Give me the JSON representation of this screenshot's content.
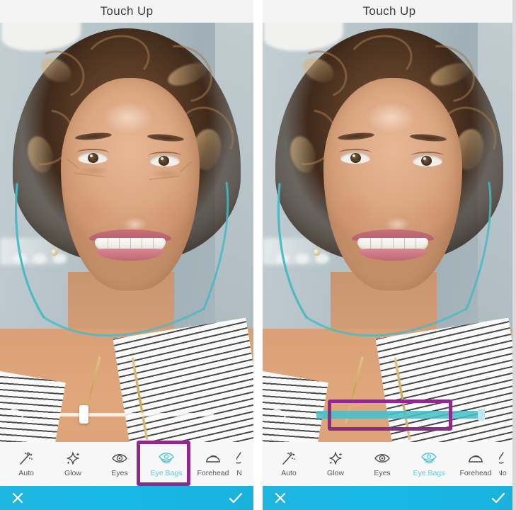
{
  "app": {
    "title": "Touch Up"
  },
  "panels": [
    {
      "id": "before",
      "title": "Touch Up",
      "slider": {
        "style": "white",
        "value_percent": 22,
        "track_color": "#ffffff",
        "knob_color": "#fdfdfd"
      },
      "undo_icon": "undo-arrow-icon",
      "highlight": {
        "target": "tool-eye-bags",
        "color": "#8e2a8b"
      },
      "tools": [
        {
          "label": "Auto",
          "icon": "magic-wand-icon",
          "active": false
        },
        {
          "label": "Glow",
          "icon": "sparkle-star-icon",
          "active": false
        },
        {
          "label": "Eyes",
          "icon": "eye-icon",
          "active": false
        },
        {
          "label": "Eye Bags",
          "icon": "eye-bags-icon",
          "active": true
        },
        {
          "label": "Forehead",
          "icon": "forehead-arch-icon",
          "active": false
        },
        {
          "label": "N",
          "icon": "nose-icon",
          "active": false
        }
      ],
      "actions": {
        "cancel_icon": "close-x-icon",
        "confirm_icon": "checkmark-icon",
        "bar_color": "#19b4e0"
      }
    },
    {
      "id": "after",
      "title": "Touch Up",
      "slider": {
        "style": "teal",
        "value_percent": 88,
        "track_color": "#49bfc9",
        "knob_color": "#bfe9ee"
      },
      "undo_icon": "undo-arrow-icon",
      "highlight": {
        "target": "intensity-slider",
        "color": "#8e2a8b"
      },
      "tools": [
        {
          "label": "Auto",
          "icon": "magic-wand-icon",
          "active": false
        },
        {
          "label": "Glow",
          "icon": "sparkle-star-icon",
          "active": false
        },
        {
          "label": "Eyes",
          "icon": "eye-icon",
          "active": false
        },
        {
          "label": "Eye Bags",
          "icon": "eye-bags-icon",
          "active": true
        },
        {
          "label": "Forehead",
          "icon": "forehead-arch-icon",
          "active": false
        },
        {
          "label": "No",
          "icon": "nose-icon",
          "active": false
        }
      ],
      "actions": {
        "cancel_icon": "close-x-icon",
        "confirm_icon": "checkmark-icon",
        "bar_color": "#19b4e0"
      }
    }
  ],
  "photo": {
    "subject": "smiling-woman-portrait",
    "face_detect_overlay_color": "#46b9c4"
  }
}
